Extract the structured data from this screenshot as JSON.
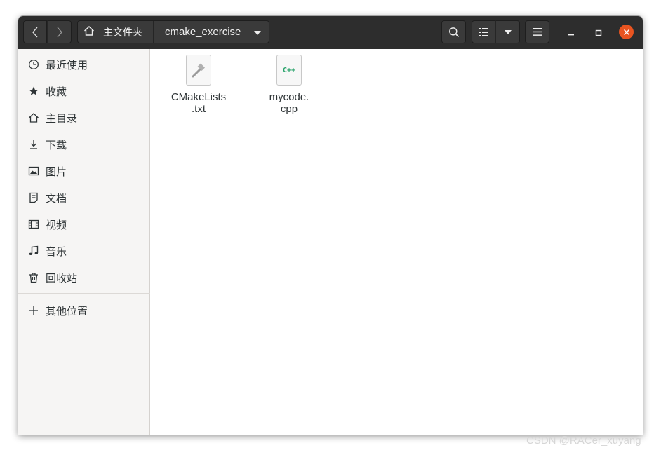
{
  "headerbar": {
    "path": {
      "home_label": "主文件夹",
      "current_folder": "cmake_exercise"
    },
    "icons": {
      "back": "chevron-left-icon",
      "forward": "chevron-right-icon",
      "home": "home-icon",
      "path_dropdown": "caret-down-icon",
      "search": "search-icon",
      "view_list": "list-view-icon",
      "view_options": "caret-down-icon",
      "menu": "hamburger-menu-icon",
      "minimize": "minimize-icon",
      "maximize": "maximize-icon",
      "close": "close-icon"
    },
    "colors": {
      "background": "#2d2d2d",
      "close_button": "#e95420"
    }
  },
  "sidebar": {
    "items": [
      {
        "label": "最近使用",
        "icon": "clock-icon"
      },
      {
        "label": "收藏",
        "icon": "star-icon"
      },
      {
        "label": "主目录",
        "icon": "home-icon"
      },
      {
        "label": "下载",
        "icon": "download-icon"
      },
      {
        "label": "图片",
        "icon": "image-icon"
      },
      {
        "label": "文档",
        "icon": "document-icon"
      },
      {
        "label": "视频",
        "icon": "film-icon"
      },
      {
        "label": "音乐",
        "icon": "music-icon"
      },
      {
        "label": "回收站",
        "icon": "trash-icon"
      }
    ],
    "other_locations": {
      "label": "其他位置",
      "icon": "plus-icon"
    }
  },
  "files": [
    {
      "name_line1": "CMakeLists",
      "name_line2": ".txt",
      "icon": "cmake-file-icon"
    },
    {
      "name_line1": "mycode.",
      "name_line2": "cpp",
      "icon": "cpp-file-icon",
      "icon_text": "C++"
    }
  ],
  "watermark": "CSDN @RACer_xuyang"
}
